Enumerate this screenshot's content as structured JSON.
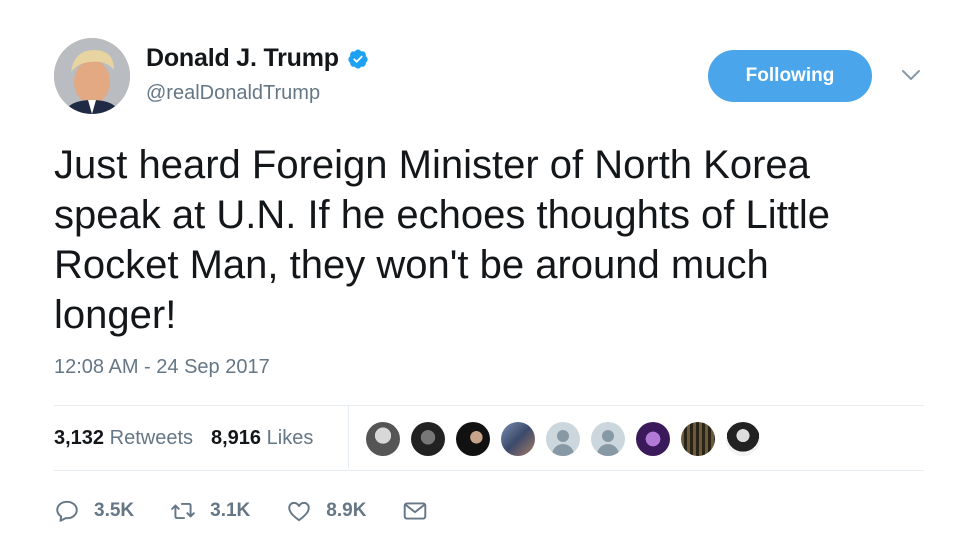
{
  "tweet": {
    "author": {
      "display_name": "Donald J. Trump",
      "handle": "@realDonaldTrump",
      "verified": true
    },
    "follow_button_label": "Following",
    "text": "Just heard Foreign Minister of North Korea\nspeak at U.N. If he echoes thoughts of Little\nRocket Man, they won't be around much\nlonger!",
    "timestamp": "12:08 AM - 24 Sep 2017",
    "stats": {
      "retweets_count": "3,132",
      "retweets_label": "Retweets",
      "likes_count": "8,916",
      "likes_label": "Likes"
    },
    "actions": {
      "reply_count": "3.5K",
      "retweet_count": "3.1K",
      "like_count": "8.9K"
    }
  },
  "icons": [
    "verified-badge-icon",
    "caret-down-icon",
    "reply-icon",
    "retweet-icon",
    "heart-icon",
    "message-icon"
  ],
  "colors": {
    "accent": "#4aa5ea",
    "secondary_text": "#657786",
    "primary_text": "#14171a"
  }
}
